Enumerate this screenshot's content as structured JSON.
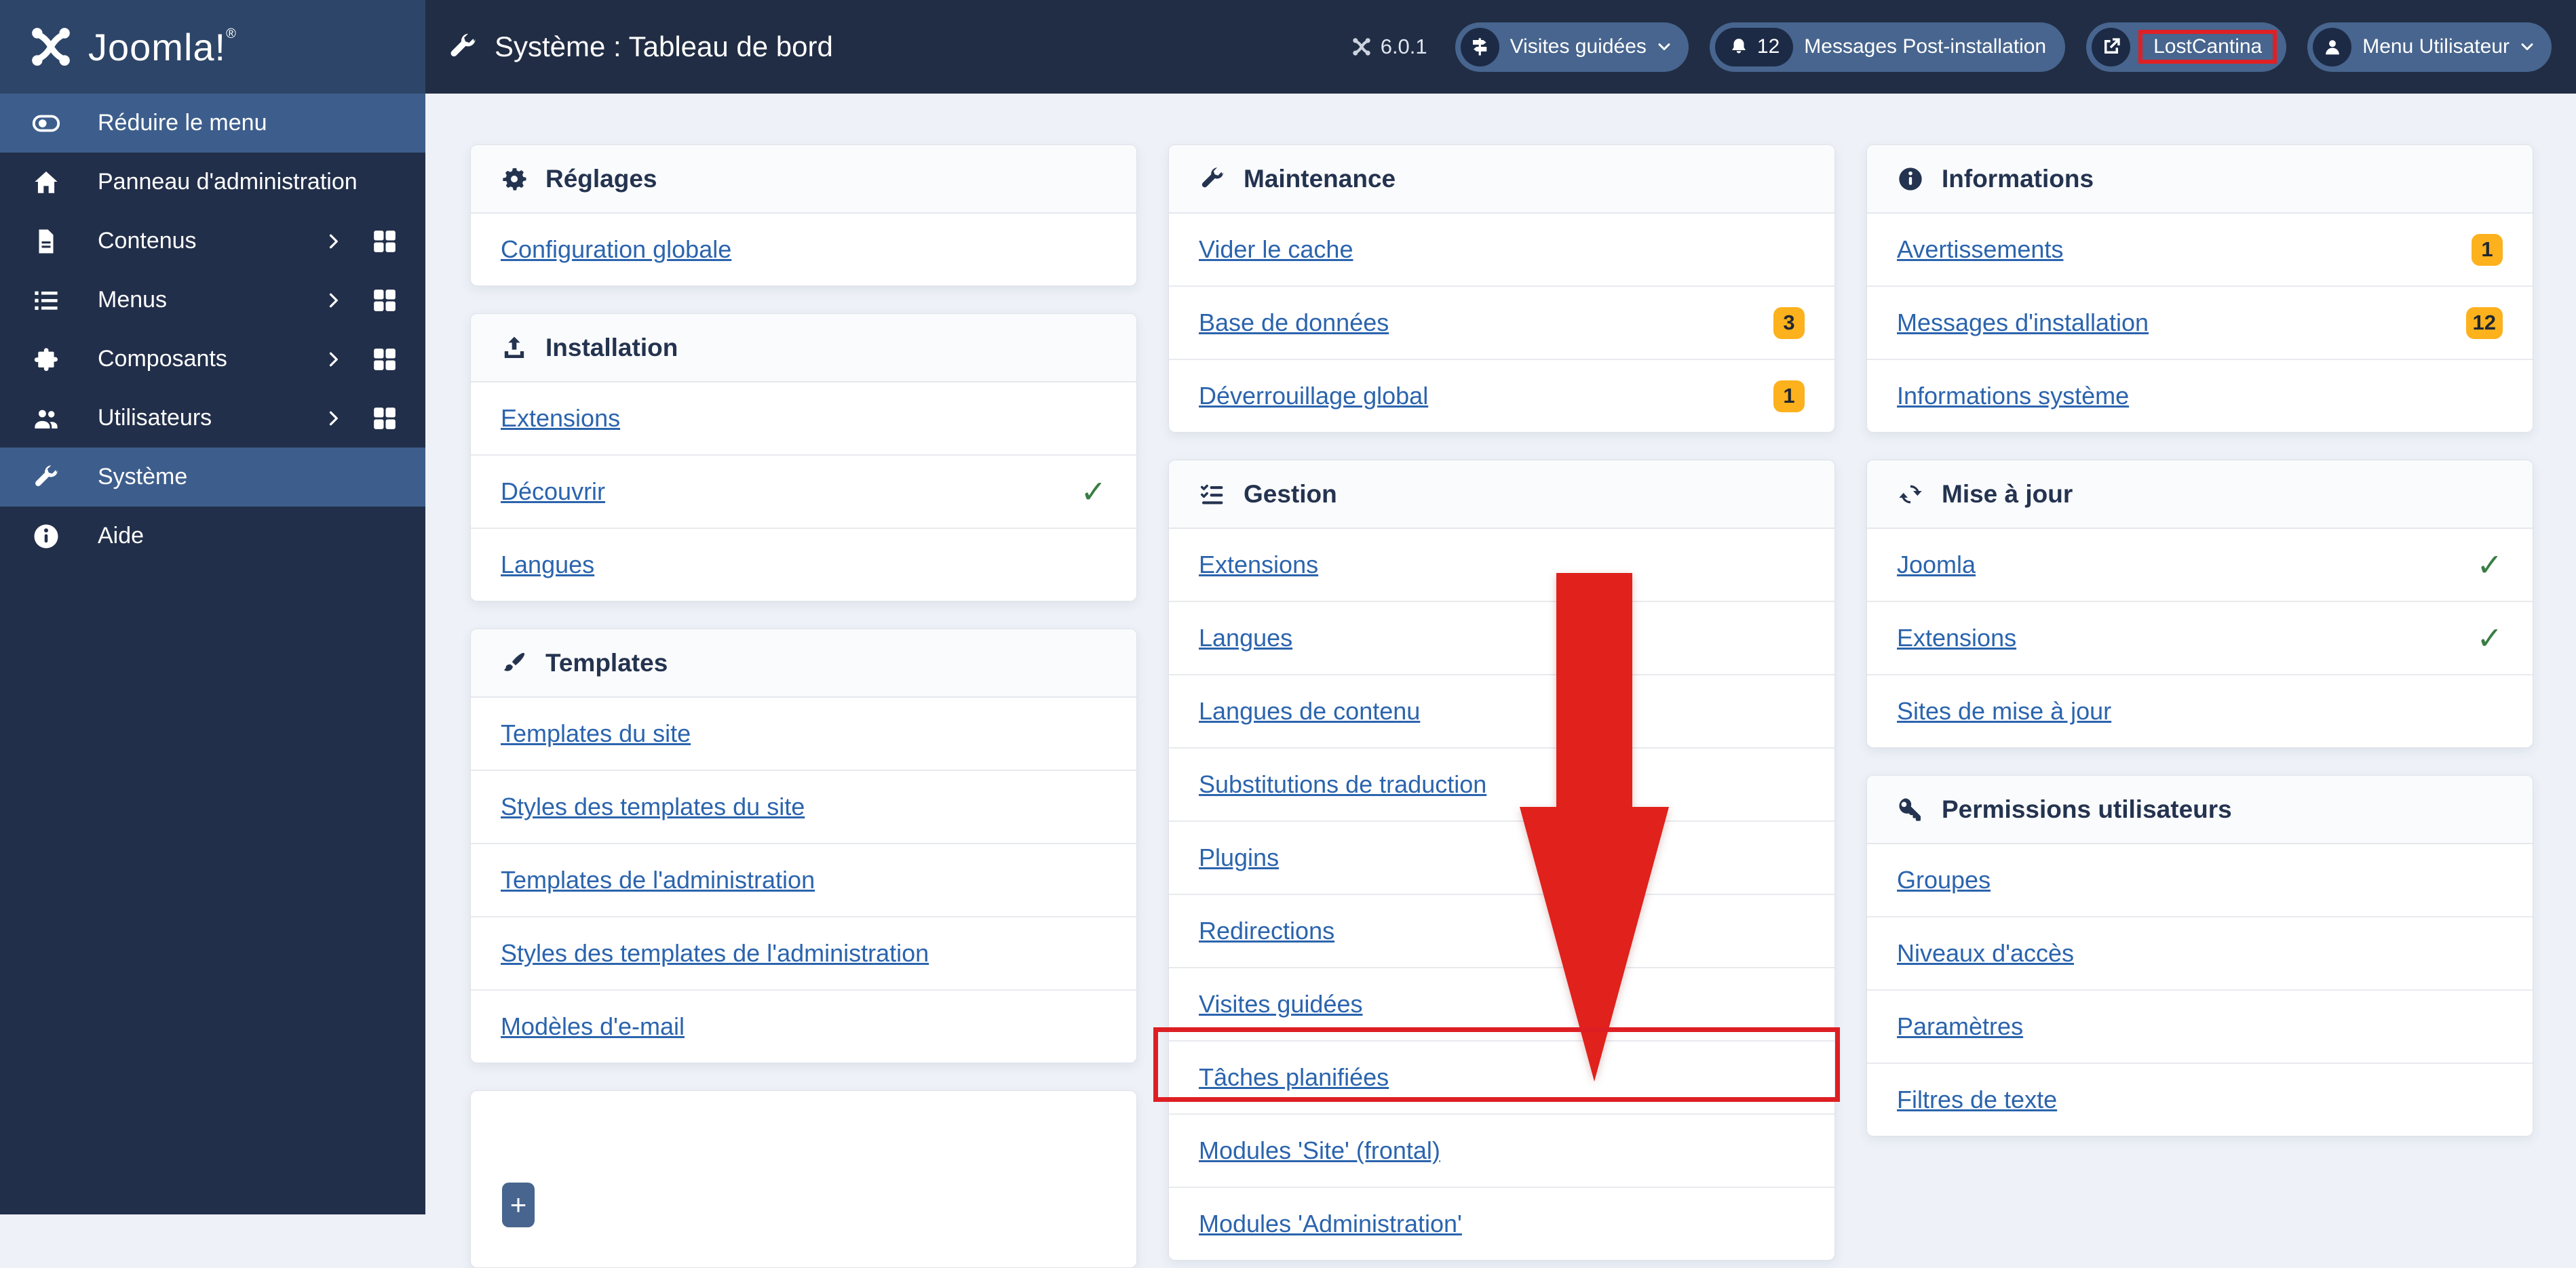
{
  "topbar": {
    "logo": "Joomla!",
    "logo_reg": "®",
    "title": "Système : Tableau de bord",
    "version": "6.0.1",
    "pills": {
      "guided_tours": "Visites guidées",
      "messages_count": "12",
      "messages": "Messages Post-installation",
      "site_name": "LostCantina",
      "user_menu": "Menu Utilisateur"
    }
  },
  "sidebar": {
    "items": [
      {
        "label": "Réduire le menu"
      },
      {
        "label": "Panneau d'administration"
      },
      {
        "label": "Contenus"
      },
      {
        "label": "Menus"
      },
      {
        "label": "Composants"
      },
      {
        "label": "Utilisateurs"
      },
      {
        "label": "Système"
      },
      {
        "label": "Aide"
      }
    ]
  },
  "icons": {
    "check": "✓",
    "plus": "+"
  },
  "columns": [
    {
      "cards": [
        {
          "title": "Réglages",
          "rows": [
            {
              "label": "Configuration globale"
            }
          ]
        },
        {
          "title": "Installation",
          "rows": [
            {
              "label": "Extensions"
            },
            {
              "label": "Découvrir",
              "check": true
            },
            {
              "label": "Langues"
            }
          ]
        },
        {
          "title": "Templates",
          "rows": [
            {
              "label": "Templates du site"
            },
            {
              "label": "Styles des templates du site"
            },
            {
              "label": "Templates de l'administration"
            },
            {
              "label": "Styles des templates de l'administration"
            },
            {
              "label": "Modèles d'e-mail"
            }
          ]
        }
      ]
    },
    {
      "cards": [
        {
          "title": "Maintenance",
          "rows": [
            {
              "label": "Vider le cache"
            },
            {
              "label": "Base de données",
              "badge": "3"
            },
            {
              "label": "Déverrouillage global",
              "badge": "1"
            }
          ]
        },
        {
          "title": "Gestion",
          "rows": [
            {
              "label": "Extensions"
            },
            {
              "label": "Langues"
            },
            {
              "label": "Langues de contenu"
            },
            {
              "label": "Substitutions de traduction"
            },
            {
              "label": "Plugins"
            },
            {
              "label": "Redirections"
            },
            {
              "label": "Visites guidées"
            },
            {
              "label": "Tâches planifiées",
              "highlighted": true
            },
            {
              "label": "Modules 'Site' (frontal)"
            },
            {
              "label": "Modules 'Administration'"
            }
          ]
        }
      ]
    },
    {
      "cards": [
        {
          "title": "Informations",
          "rows": [
            {
              "label": "Avertissements",
              "badge": "1"
            },
            {
              "label": "Messages d'installation",
              "badge": "12"
            },
            {
              "label": "Informations système"
            }
          ]
        },
        {
          "title": "Mise à jour",
          "rows": [
            {
              "label": "Joomla",
              "check": true
            },
            {
              "label": "Extensions",
              "check": true
            },
            {
              "label": "Sites de mise à jour"
            }
          ]
        },
        {
          "title": "Permissions utilisateurs",
          "rows": [
            {
              "label": "Groupes"
            },
            {
              "label": "Niveaux d'accès"
            },
            {
              "label": "Paramètres"
            },
            {
              "label": "Filtres de texte"
            }
          ]
        }
      ]
    }
  ],
  "colors": {
    "annotation_red": "#df2025",
    "badge_yellow": "#fcb11d",
    "link_blue": "#2b64ad",
    "check_green": "#3a7d44",
    "topbar_navy": "#212d44",
    "sidebar_navy": "#222f4a",
    "active_steel_blue": "#3d5e8c"
  }
}
